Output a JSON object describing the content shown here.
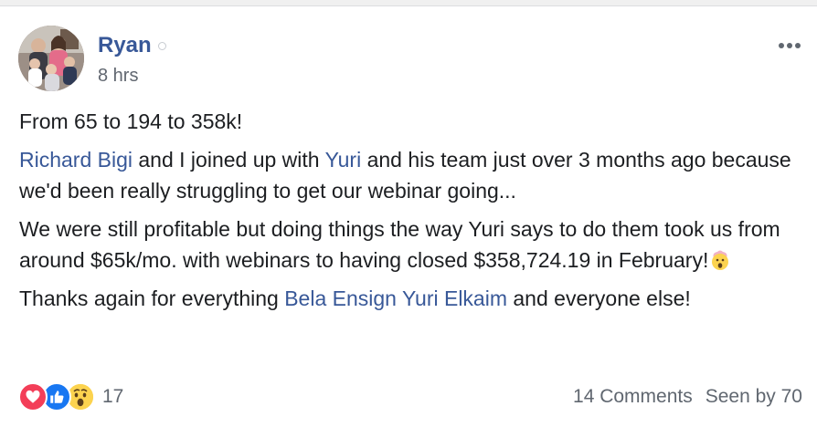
{
  "post": {
    "author": "Ryan",
    "timestamp": "8 hrs",
    "headline": "From 65 to 194 to 358k!",
    "paragraph2": {
      "mention1": "Richard Bigi",
      "text1": " and I joined up with ",
      "mention2": "Yuri",
      "text2": " and his team just over 3 months ago because we'd been really struggling to get our webinar going..."
    },
    "paragraph3": {
      "text": "We were still profitable but doing things the way Yuri says to do them took us from around $65k/mo. with webinars to having closed $358,724.19 in February!",
      "emoji": "exploding-head-emoji"
    },
    "paragraph4": {
      "text1": "Thanks again for everything ",
      "mention1": "Bela Ensign",
      "text2": " ",
      "mention2": "Yuri Elkaim",
      "text3": " and everyone else!"
    }
  },
  "footer": {
    "reactions": [
      "love-icon",
      "like-icon",
      "wow-icon"
    ],
    "reaction_count": "17",
    "comments": "14 Comments",
    "seen_by": "Seen by 70"
  },
  "colors": {
    "link": "#385898",
    "text": "#1c1e21",
    "meta": "#616770",
    "love": "#f33e58",
    "like": "#1877f2",
    "wow": "#fcd34f"
  }
}
